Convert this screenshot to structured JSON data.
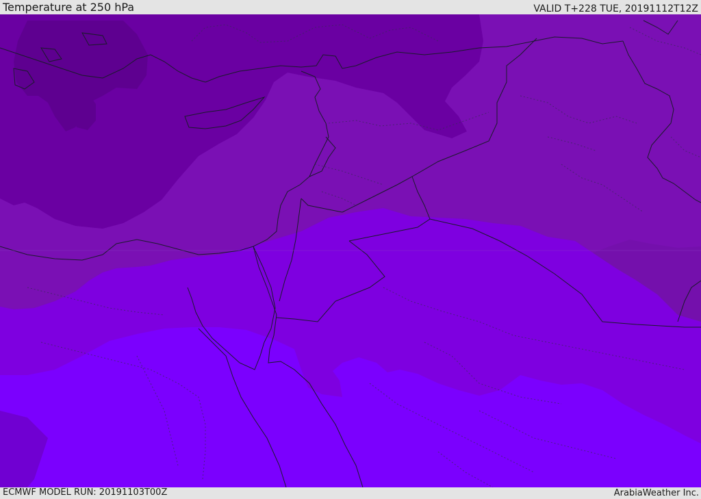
{
  "header": {
    "title": "Temperature at 250 hPa",
    "valid": "VALID T+228 TUE, 20191112T12Z"
  },
  "footer": {
    "model_run": "ECMWF MODEL RUN: 20191103T00Z",
    "credit": "ArabiaWeather Inc."
  },
  "colors": {
    "band_coldest": "#5e0090",
    "band_cold": "#6a00a2",
    "band_mid": "#7a10b4",
    "band_mid2": "#7a00c8",
    "band_warm": "#7e00e0",
    "band_warmest": "#7b00fe",
    "top_bar": "#e4e4e4",
    "bottom_bar": "#e4e4e4"
  }
}
